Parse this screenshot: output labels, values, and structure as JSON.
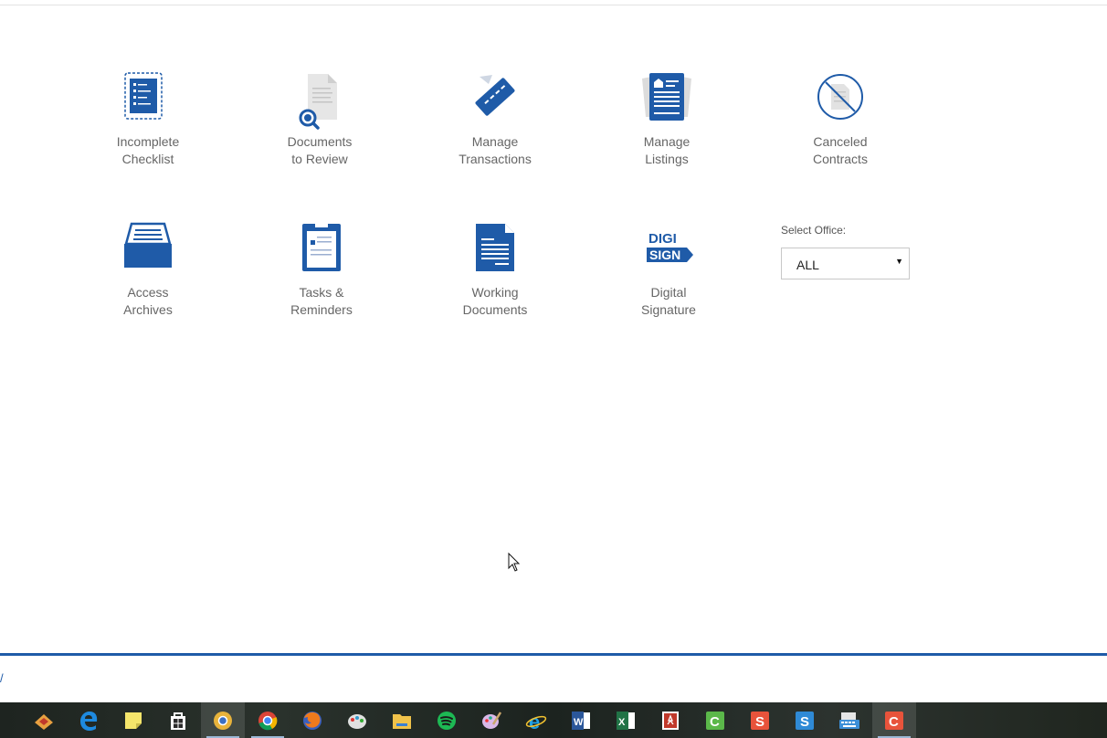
{
  "tiles": [
    {
      "line1": "Incomplete",
      "line2": "Checklist",
      "icon": "checklist-icon"
    },
    {
      "line1": "Documents",
      "line2": "to Review",
      "icon": "document-search-icon"
    },
    {
      "line1": "Manage",
      "line2": "Transactions",
      "icon": "tag-icon"
    },
    {
      "line1": "Manage",
      "line2": "Listings",
      "icon": "listing-icon"
    },
    {
      "line1": "Canceled",
      "line2": "Contracts",
      "icon": "canceled-document-icon"
    },
    {
      "line1": "Access",
      "line2": "Archives",
      "icon": "archive-tray-icon"
    },
    {
      "line1": "Tasks &",
      "line2": "Reminders",
      "icon": "clipboard-icon"
    },
    {
      "line1": "Working",
      "line2": "Documents",
      "icon": "document-icon"
    },
    {
      "line1": "Digital",
      "line2": "Signature",
      "icon": "digisign-icon",
      "logo_text": [
        "DIGI",
        "SIGN"
      ]
    }
  ],
  "office": {
    "label": "Select Office:",
    "selected": "ALL"
  },
  "footer": {
    "link_text": "/"
  },
  "colors": {
    "brand_blue": "#1f5ba8",
    "label_gray": "#666666"
  },
  "taskbar": {
    "apps": [
      "task-view-icon",
      "fusion-icon",
      "edge-icon",
      "sticky-notes-icon",
      "store-icon",
      "chrome-canary-icon",
      "chrome-icon",
      "firefox-icon",
      "paint-icon",
      "file-explorer-icon",
      "spotify-icon",
      "paint-brush-icon",
      "internet-explorer-icon",
      "word-icon",
      "excel-icon",
      "acrobat-icon",
      "camtasia-icon",
      "snagit-icon",
      "snagit-editor-icon",
      "keyboard-icon",
      "camtasia-recorder-icon"
    ]
  }
}
